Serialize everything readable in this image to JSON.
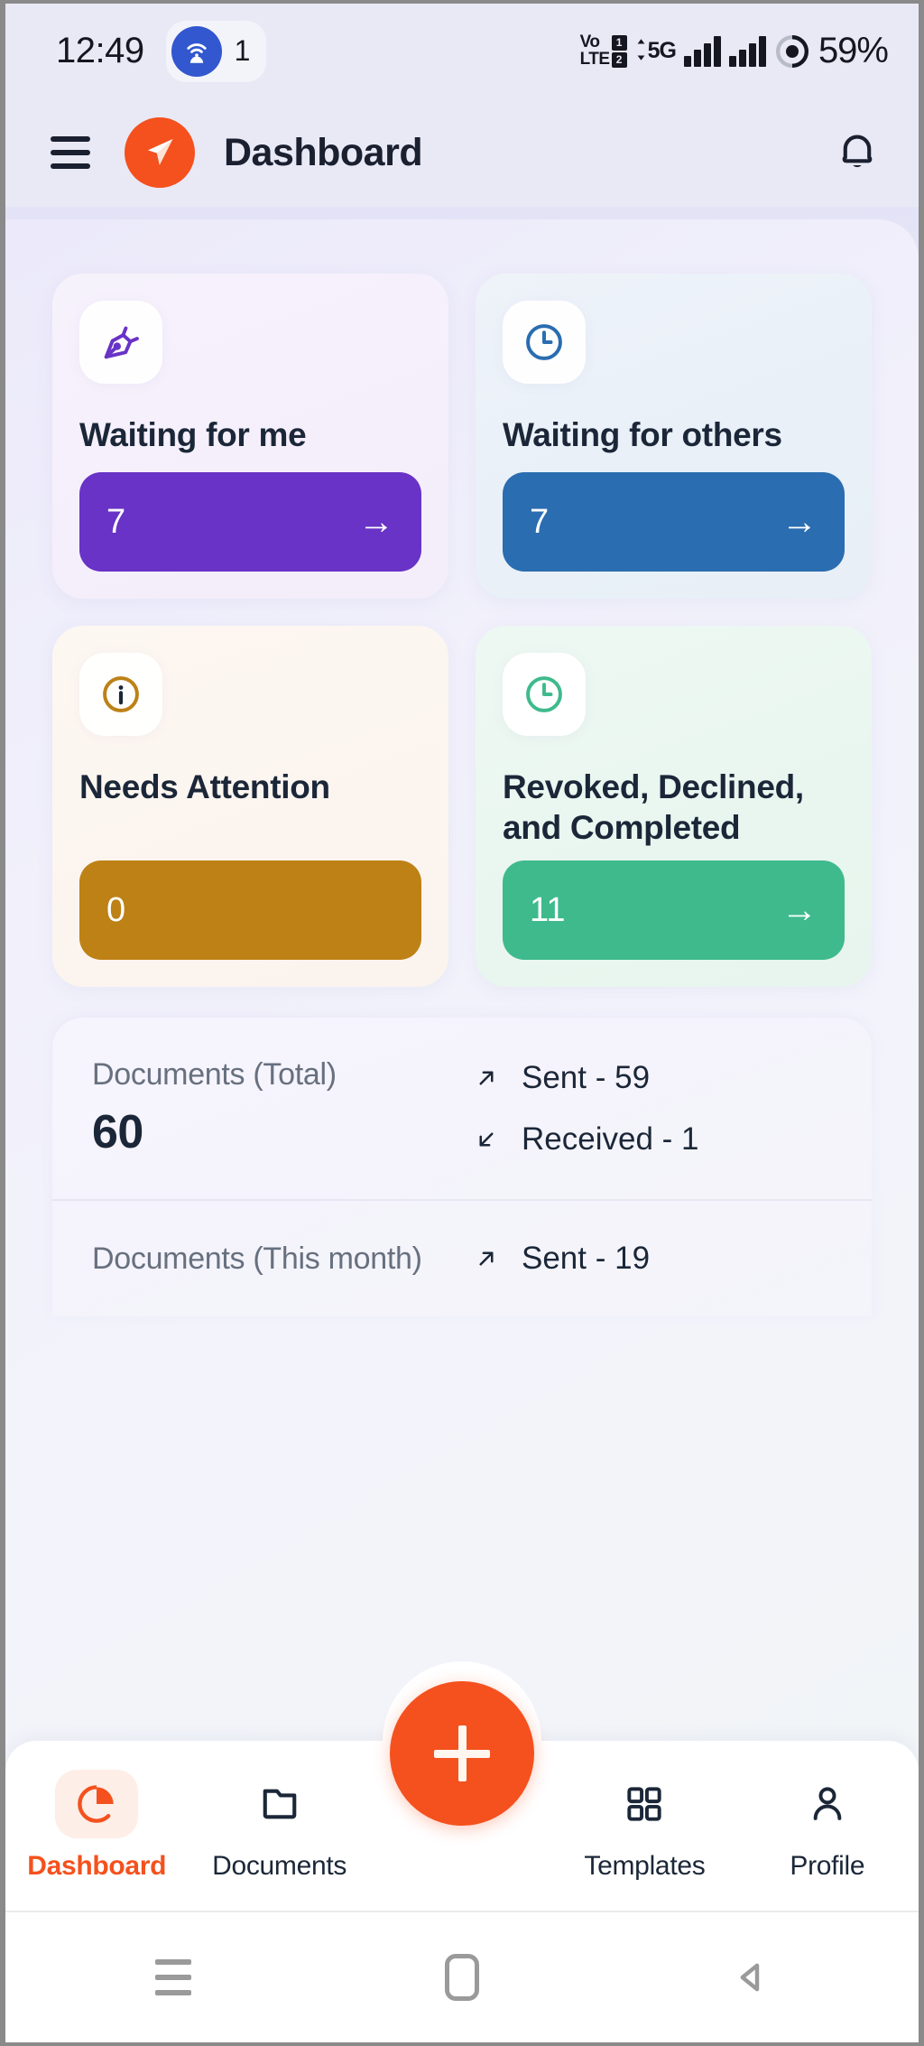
{
  "status_bar": {
    "time": "12:49",
    "wifi_icon": "wifi-hotspot-icon",
    "connected_count": "1",
    "volte_line1": "Vo",
    "volte_line2": "LTE",
    "sim1": "1",
    "sim2": "2",
    "network_type": "5G",
    "battery_percent": "59%"
  },
  "header": {
    "menu_icon": "hamburger-menu-icon",
    "logo_icon": "app-logo-paper-plane-icon",
    "title": "Dashboard",
    "notification_icon": "bell-icon",
    "brand_color": "#f4511e"
  },
  "cards": [
    {
      "id": "waiting-for-me",
      "icon": "pen-nib-icon",
      "title": "Waiting for me",
      "count": "7",
      "arrow": "→",
      "accent": "#6833c6",
      "has_arrow": true
    },
    {
      "id": "waiting-for-others",
      "icon": "clock-icon",
      "title": "Waiting for others",
      "count": "7",
      "arrow": "→",
      "accent": "#2a6db0",
      "has_arrow": true
    },
    {
      "id": "needs-attention",
      "icon": "info-circle-icon",
      "title": "Needs Attention",
      "count": "0",
      "arrow": "",
      "accent": "#bd8116",
      "has_arrow": false
    },
    {
      "id": "revoked-declined-completed",
      "icon": "clock-icon",
      "title": "Revoked, Declined, and Completed",
      "count": "11",
      "arrow": "→",
      "accent": "#3fba8d",
      "has_arrow": true
    }
  ],
  "stats": {
    "rows": [
      {
        "label": "Documents (Total)",
        "value": "60",
        "sent_icon": "arrow-up-right-icon",
        "sent": "Sent - 59",
        "received_icon": "arrow-down-left-icon",
        "received": "Received - 1"
      },
      {
        "label": "Documents (This month)",
        "value": "",
        "sent_icon": "arrow-up-right-icon",
        "sent": "Sent - 19",
        "received_icon": "arrow-down-left-icon",
        "received": ""
      }
    ]
  },
  "fab": {
    "icon": "plus-icon",
    "color": "#f4511e"
  },
  "bottom_nav": {
    "items": [
      {
        "id": "dashboard",
        "icon": "pie-chart-icon",
        "label": "Dashboard",
        "active": true
      },
      {
        "id": "documents",
        "icon": "folder-icon",
        "label": "Documents",
        "active": false
      },
      {
        "id": "templates",
        "icon": "grid-icon",
        "label": "Templates",
        "active": false
      },
      {
        "id": "profile",
        "icon": "person-icon",
        "label": "Profile",
        "active": false
      }
    ]
  },
  "android_nav": {
    "recents_icon": "recents-icon",
    "home_icon": "home-icon",
    "back_icon": "back-icon"
  }
}
